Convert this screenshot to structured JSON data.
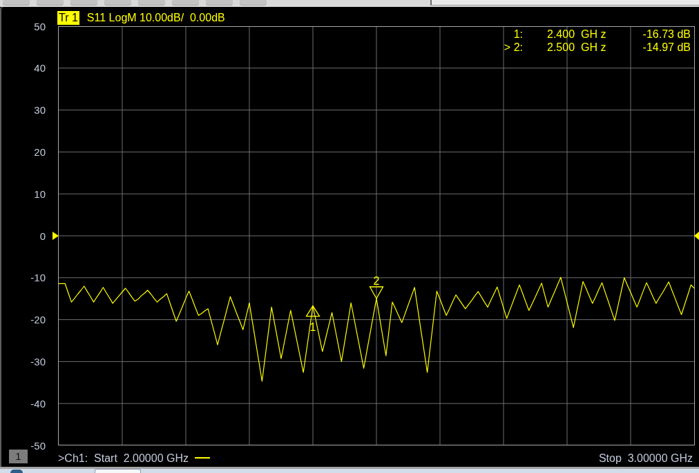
{
  "trace_header": {
    "trace_label": "Tr 1",
    "settings": "S11 LogM 10.00dB/  0.00dB"
  },
  "chart": {
    "chart_data": {
      "type": "line",
      "grid": true,
      "categories": [
        null,
        null,
        null,
        null,
        null,
        null,
        null,
        null,
        null,
        null,
        null,
        null,
        null,
        null,
        null,
        null,
        null,
        null,
        null,
        null,
        null,
        null,
        null,
        null,
        null,
        null,
        null,
        null,
        null,
        null,
        null,
        null,
        null,
        null,
        null,
        null,
        null,
        null,
        null,
        null,
        null,
        null,
        null,
        null,
        null,
        null,
        null,
        null,
        null,
        null,
        null,
        null,
        null,
        null,
        null,
        null,
        null,
        null,
        null,
        null,
        null,
        null,
        null,
        null,
        null,
        null,
        null,
        null,
        null,
        null,
        null,
        null,
        null,
        null,
        null,
        null,
        null,
        null,
        null,
        null,
        null,
        null,
        null,
        null,
        null,
        null,
        null,
        null,
        null,
        null,
        null,
        null,
        null,
        null,
        null,
        null,
        null,
        null,
        null,
        null,
        null,
        null,
        null,
        null,
        null,
        null,
        null,
        null,
        null,
        null,
        null,
        null,
        null,
        null,
        null,
        null,
        null,
        null,
        null,
        null,
        null,
        null,
        null,
        null,
        null,
        null,
        null,
        null,
        null,
        null,
        null,
        null,
        null,
        null,
        null,
        null,
        null,
        null,
        null,
        null,
        null,
        null,
        null,
        null,
        null,
        null,
        null,
        null,
        null,
        null,
        null,
        null,
        null,
        null,
        null,
        null,
        null,
        null,
        null,
        null,
        null,
        null,
        null,
        null,
        null,
        null,
        null,
        null,
        null,
        null,
        null,
        null,
        null,
        null,
        null,
        null,
        null,
        null,
        null,
        null,
        null,
        null,
        null,
        null,
        null,
        null,
        null,
        null,
        null,
        null,
        null,
        null,
        null,
        null,
        null,
        null,
        null,
        null,
        null,
        null,
        null
      ],
      "values": [
        -11.4,
        -11.4,
        -11.4,
        -13.6,
        -15.8,
        -14.9,
        -13.9,
        -13.0,
        -12,
        -13.3,
        -14.5,
        -15.8,
        -14.6,
        -13.5,
        -12.3,
        -13.6,
        -14.8,
        -16.1,
        -15.2,
        -14.3,
        -13.4,
        -12.5,
        -13.5,
        -14.6,
        -15.6,
        -15.1,
        -14.3,
        -13.7,
        -13,
        -13.9,
        -14.9,
        -15.8,
        -15.1,
        -14.5,
        -13.8,
        -16.0,
        -18.2,
        -20.4,
        -18.6,
        -16.8,
        -14.9,
        -13.2,
        -15.1,
        -17.1,
        -19,
        -18.5,
        -17.9,
        -17.4,
        -20.3,
        -23.1,
        -26,
        -23.1,
        -20.3,
        -17.4,
        -14.5,
        -16.5,
        -18.5,
        -20.4,
        -22.4,
        -19.2,
        -16,
        -20.7,
        -25.4,
        -30.0,
        -34.7,
        -28.8,
        -22.9,
        -17,
        -21.1,
        -25.2,
        -29.3,
        -25.5,
        -21.6,
        -17.8,
        -21.5,
        -25.2,
        -28.9,
        -32.6,
        -27.3,
        -22.0,
        -16.7,
        -20.4,
        -24.0,
        -27.6,
        -24.5,
        -21.4,
        -18.3,
        -22.2,
        -26.1,
        -30,
        -25.3,
        -20.7,
        -16,
        -19.9,
        -23.8,
        -27.7,
        -31.6,
        -27.4,
        -23.3,
        -19.1,
        -15.0,
        -19.5,
        -24.1,
        -28.6,
        -22.2,
        -15.8,
        -17.4,
        -19.1,
        -20.7,
        -18.6,
        -16.5,
        -14.4,
        -12.3,
        -17.4,
        -22.5,
        -27.5,
        -32.6,
        -26.1,
        -19.7,
        -13.2,
        -15.1,
        -17.1,
        -19,
        -17.4,
        -15.7,
        -14.1,
        -15.2,
        -16.3,
        -17.4,
        -16.4,
        -15.4,
        -14.3,
        -13.3,
        -14.5,
        -15.8,
        -17,
        -15.4,
        -13.8,
        -12.2,
        -14.7,
        -17.2,
        -19.7,
        -17.7,
        -15.7,
        -13.7,
        -11.7,
        -13.7,
        -15.8,
        -17.8,
        -16.2,
        -14.6,
        -12.9,
        -11.3,
        -14.2,
        -17,
        -15.2,
        -13.5,
        -11.7,
        -9.9,
        -12.9,
        -15.9,
        -18.9,
        -21.9,
        -18.2,
        -14.6,
        -10.9,
        -12.6,
        -14.4,
        -16.1,
        -14.5,
        -12.8,
        -11.2,
        -13.5,
        -15.7,
        -18.0,
        -20.2,
        -16.8,
        -13.4,
        -10,
        -11.8,
        -13.5,
        -15.3,
        -17,
        -15.1,
        -13.1,
        -11.2,
        -12.8,
        -14.5,
        -16.1,
        -14.8,
        -13.6,
        -12.3,
        -11,
        -13.0,
        -14.9,
        -16.9,
        -18.8,
        -16.4,
        -14.1,
        -11.7,
        -12.5
      ],
      "ylim": [
        -50,
        50
      ],
      "yticks": [
        50,
        40,
        30,
        20,
        10,
        0,
        -10,
        -20,
        -30,
        -40,
        -50
      ],
      "annotations": [
        {
          "text": "1",
          "y": -16.73
        },
        {
          "text": "2",
          "y": -14.97
        }
      ]
    },
    "marker_readout": [
      {
        "number": "1:",
        "frequency": "2.400  GH z",
        "value": "-16.73 dB",
        "active": false
      },
      {
        "number": "> 2:",
        "frequency": "2.500  GH z",
        "value": "-14.97 dB",
        "active": true
      }
    ]
  },
  "channel_bar": {
    "channel": "1",
    "start": ">Ch1:  Start  2.00000 GHz",
    "stop": "Stop  3.00000 GHz"
  }
}
